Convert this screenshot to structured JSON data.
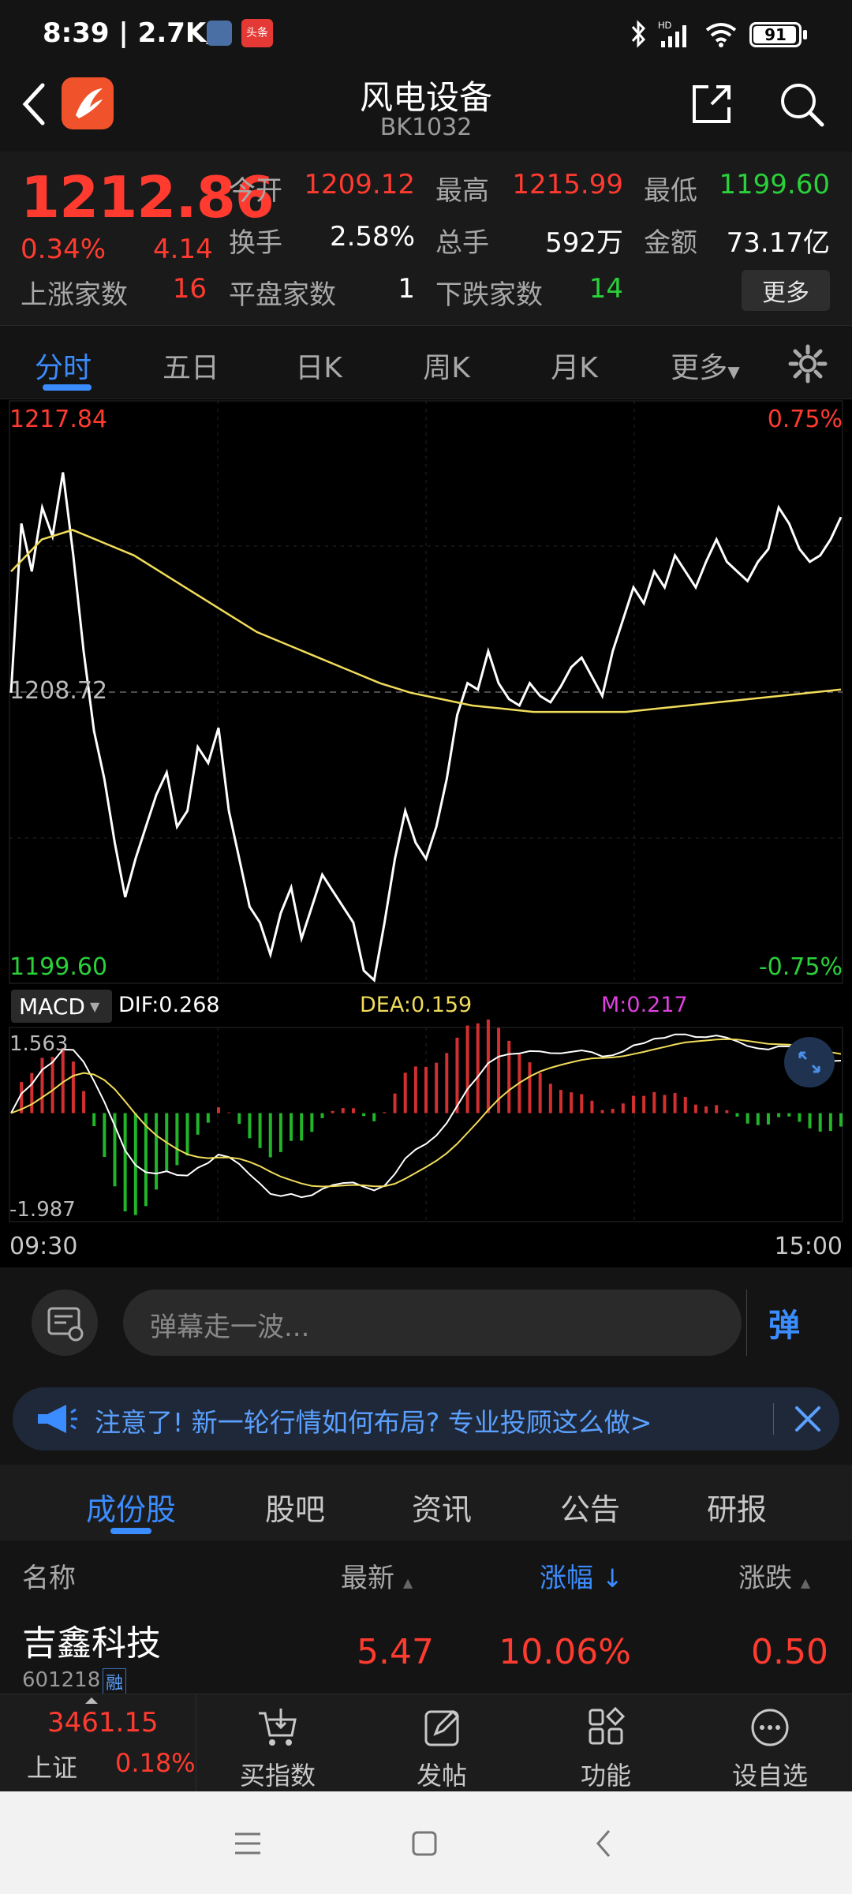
{
  "status_bar": {
    "time": "8:39 | 2.7K/s",
    "battery": "91",
    "notif_badge": "头条"
  },
  "header": {
    "title": "风电设备",
    "code": "BK1032"
  },
  "quote": {
    "price": "1212.86",
    "change_pct": "0.34%",
    "change": "4.14",
    "open_label": "今开",
    "open": "1209.12",
    "high_label": "最高",
    "high": "1215.99",
    "low_label": "最低",
    "low": "1199.60",
    "turnover_label": "换手",
    "turnover": "2.58%",
    "volume_label": "总手",
    "volume": "592万",
    "amount_label": "金额",
    "amount": "73.17亿",
    "up_label": "上涨家数",
    "up": "16",
    "flat_label": "平盘家数",
    "flat": "1",
    "down_label": "下跌家数",
    "down": "14",
    "more_button": "更多"
  },
  "tabs": {
    "items": [
      "分时",
      "五日",
      "日K",
      "周K",
      "月K",
      "更多"
    ],
    "active": 0
  },
  "chart": {
    "top_price": "1217.84",
    "top_pct": "0.75%",
    "mid_price": "1208.72",
    "bottom_price": "1199.60",
    "bottom_pct": "-0.75%",
    "macd_label": "MACD",
    "dif": "DIF:0.268",
    "dea": "DEA:0.159",
    "m": "M:0.217",
    "macd_high": "1.563",
    "macd_low": "-1.987",
    "time_start": "09:30",
    "time_end": "15:00"
  },
  "chart_data": {
    "type": "line",
    "title": "",
    "xlabel": "",
    "ylabel": "",
    "x_start": "09:30",
    "x_end": "15:00",
    "ylim": [
      1199.6,
      1217.84
    ],
    "reference": 1208.72,
    "series": [
      {
        "name": "价格",
        "color": "#ffffff",
        "values": [
          1208.7,
          1214.0,
          1212.5,
          1214.5,
          1213.6,
          1215.6,
          1213.0,
          1210.0,
          1207.5,
          1206.0,
          1204.0,
          1202.3,
          1203.5,
          1204.5,
          1205.5,
          1206.2,
          1204.5,
          1205.0,
          1207.0,
          1206.5,
          1207.6,
          1205.0,
          1203.5,
          1202.0,
          1201.5,
          1200.5,
          1201.8,
          1202.6,
          1201.0,
          1202.0,
          1203.0,
          1202.5,
          1202.0,
          1201.5,
          1200.0,
          1199.7,
          1201.5,
          1203.5,
          1205.0,
          1204.0,
          1203.5,
          1204.5,
          1206.0,
          1208.0,
          1209.0,
          1208.8,
          1210.0,
          1209.0,
          1208.5,
          1208.3,
          1209.0,
          1208.6,
          1208.4,
          1208.9,
          1209.5,
          1209.8,
          1209.2,
          1208.6,
          1210.0,
          1211.0,
          1212.0,
          1211.5,
          1212.5,
          1212.0,
          1213.0,
          1212.5,
          1212.0,
          1212.8,
          1213.5,
          1212.8,
          1212.5,
          1212.2,
          1212.8,
          1213.2,
          1214.5,
          1214.0,
          1213.2,
          1212.8,
          1213.0,
          1213.5,
          1214.2
        ]
      },
      {
        "name": "均价",
        "color": "#f0dc5a",
        "values": [
          1212.5,
          1213.5,
          1213.8,
          1213.4,
          1213.0,
          1212.4,
          1211.8,
          1211.2,
          1210.6,
          1210.2,
          1209.8,
          1209.4,
          1209.0,
          1208.7,
          1208.5,
          1208.3,
          1208.2,
          1208.1,
          1208.1,
          1208.1,
          1208.1,
          1208.2,
          1208.3,
          1208.4,
          1208.5,
          1208.6,
          1208.7,
          1208.8
        ]
      }
    ],
    "macd": {
      "ylim": [
        -1.987,
        1.563
      ],
      "dif": 0.268,
      "dea": 0.159,
      "m": 0.217
    }
  },
  "danmu": {
    "placeholder": "弹幕走一波...",
    "btn": "弹"
  },
  "notice": {
    "text": "注意了! 新一轮行情如何布局? 专业投顾这么做>"
  },
  "subtabs": {
    "items": [
      "成份股",
      "股吧",
      "资讯",
      "公告",
      "研报"
    ],
    "active": 0
  },
  "table": {
    "headers": {
      "name": "名称",
      "latest": "最新",
      "pct": "涨幅",
      "chg": "涨跌"
    },
    "rows": [
      {
        "name": "吉鑫科技",
        "code": "601218",
        "tag": "融",
        "latest": "5.47",
        "pct": "10.06%",
        "chg": "0.50"
      }
    ]
  },
  "toolbar": {
    "index_value": "3461.15",
    "index_name": "上证",
    "index_pct": "0.18%",
    "items": [
      "买指数",
      "发帖",
      "功能",
      "设自选"
    ]
  }
}
